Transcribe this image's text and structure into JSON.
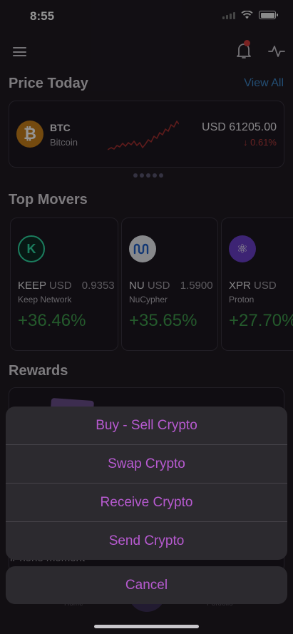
{
  "status_bar": {
    "time": "8:55"
  },
  "header": {
    "menu_icon": "hamburger-menu-icon",
    "bell_icon": "bell-icon",
    "activity_icon": "activity-pulse-icon"
  },
  "price_today": {
    "title": "Price Today",
    "view_all": "View All",
    "card": {
      "symbol": "BTC",
      "name": "Bitcoin",
      "price": "USD 61205.00",
      "change": "↓ 0.61%",
      "logo": "₿"
    }
  },
  "top_movers": {
    "title": "Top Movers",
    "items": [
      {
        "symbol": "KEEP",
        "currency": "USD",
        "price": "0.9353",
        "name": "Keep Network",
        "change": "+36.46%",
        "logo": "K",
        "logo_bg": "#1a3a33",
        "logo_fg": "#2fd8a2"
      },
      {
        "symbol": "NU",
        "currency": "USD",
        "price": "1.5900",
        "name": "NuCypher",
        "change": "+35.65%",
        "logo": "ᥒ",
        "logo_bg": "#e9eaf0",
        "logo_fg": "#1f5fc9"
      },
      {
        "symbol": "XPR",
        "currency": "USD",
        "price": "",
        "name": "Proton",
        "change": "+27.70%",
        "logo": "⚛",
        "logo_bg": "#6a3fc9",
        "logo_fg": "#ffffff"
      }
    ]
  },
  "rewards": {
    "title": "Rewards",
    "caption": "iPhone moment"
  },
  "tab_bar": {
    "home": "Home",
    "portfolio": "Portfolio"
  },
  "action_sheet": {
    "actions": [
      "Buy - Sell Crypto",
      "Swap Crypto",
      "Receive Crypto",
      "Send Crypto"
    ],
    "cancel": "Cancel"
  },
  "colors": {
    "accent": "#b75ad0",
    "positive": "#3f9b4c",
    "negative": "#b33b3b",
    "link": "#3d86c6"
  }
}
